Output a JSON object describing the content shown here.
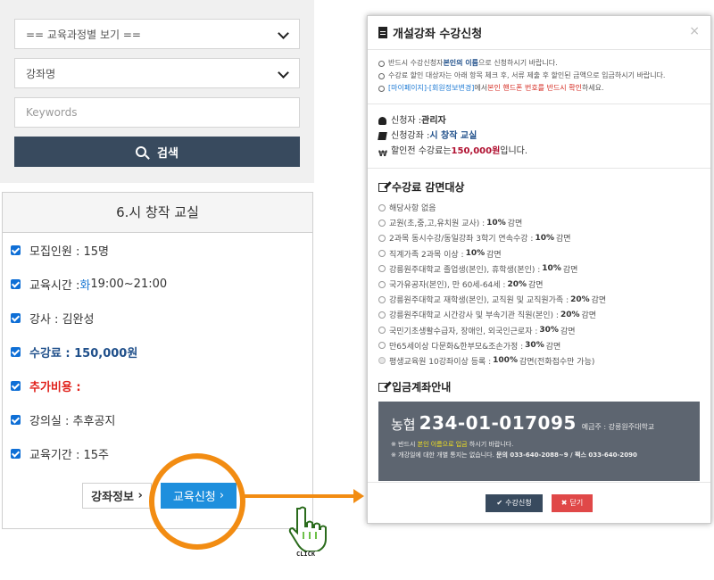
{
  "search": {
    "curriculum_select": "== 교육과정별 보기 ==",
    "course_name_select": "강좌명",
    "keyword_placeholder": "Keywords",
    "search_button": "검색"
  },
  "course": {
    "title": "6.시 창작 교실",
    "rows": {
      "recruit": "모집인원 : 15명",
      "time_label": "교육시간 : ",
      "time_day": "화",
      "time_value": " 19:00~21:00",
      "teacher": "강사 : 김완성",
      "fee": "수강료 : 150,000원",
      "extra": "추가비용 :",
      "room": "강의실 : 추후공지",
      "period": "교육기간 : 15주"
    },
    "info_button": "강좌정보",
    "apply_button": "교육신청",
    "click_label": "CLICK"
  },
  "modal": {
    "title": "개설강좌 수강신청",
    "close_symbol": "×",
    "notes": [
      {
        "a": "반드시 수강신청자 ",
        "b": "본인의 이름",
        "c": "으로 신청하시기 바랍니다."
      },
      {
        "a": "수강료 할인 대상자는 아래 항목 체크 후, 서류 제출 후 할인된 금액으로 입금하시기 바랍니다.",
        "b": "",
        "c": ""
      },
      {
        "a": "[마이페이지]-[회원정보변경]",
        "b": "에서 ",
        "c": "본인 핸드폰 번호를 반드시 확인",
        "d": "하세요."
      }
    ],
    "applicant_label": "신청자 : ",
    "applicant_name": "관리자",
    "course_label": "신청강좌 : ",
    "course_name": "시 창작 교실",
    "fee_label": "할인전 수강료는 ",
    "fee_value": "150,000원",
    "fee_suffix": " 입니다.",
    "discount_title": "수강료 감면대상",
    "options": [
      {
        "text": "해당사항 없음",
        "bold": "",
        "tail": ""
      },
      {
        "text": "교원(초,중,고,유치원 교사) :",
        "bold": "10%",
        "tail": "감면"
      },
      {
        "text": "2과목 동시수강/동일강좌 3학기 연속수강 :",
        "bold": "10%",
        "tail": "감면"
      },
      {
        "text": "직계가족 2과목 이상 :",
        "bold": "10%",
        "tail": "감면"
      },
      {
        "text": "강릉원주대학교 졸업생(본인), 휴학생(본인) :",
        "bold": "10%",
        "tail": "감면"
      },
      {
        "text": "국가유공자(본인), 만 60세-64세 :",
        "bold": "20%",
        "tail": "감면"
      },
      {
        "text": "강릉원주대학교 재학생(본인), 교직원 및 교직원가족 :",
        "bold": "20%",
        "tail": "감면"
      },
      {
        "text": "강릉원주대학교 시간강사 및 부속기관 직원(본인) :",
        "bold": "20%",
        "tail": "감면"
      },
      {
        "text": "국민기초생활수급자, 장애인, 외국인근로자 :",
        "bold": "30%",
        "tail": "감면"
      },
      {
        "text": "만65세이상 다문화&한부모&조손가정 :",
        "bold": "30%",
        "tail": "감면"
      },
      {
        "text": "평생교육원 10강좌이상 등록 :",
        "bold": "100%",
        "tail": "감면(전화접수만 가능)"
      }
    ],
    "bank_title": "입금계좌안내",
    "bank_name": "농협",
    "bank_account": "234-01-017095",
    "bank_holder": "예금주 : 강릉원주대학교",
    "bank_note1_a": "※ 반드시 ",
    "bank_note1_b": "본인 이름으로 입금",
    "bank_note1_c": " 하시기 바랍니다.",
    "bank_note2_a": "※ 개강일에 대한 개별 통지는 없습니다. ",
    "bank_note2_b": "문의 033-640-2088~9 / 팩스 033-640-2090",
    "footer_apply": "수강신청",
    "footer_close": "닫기"
  }
}
